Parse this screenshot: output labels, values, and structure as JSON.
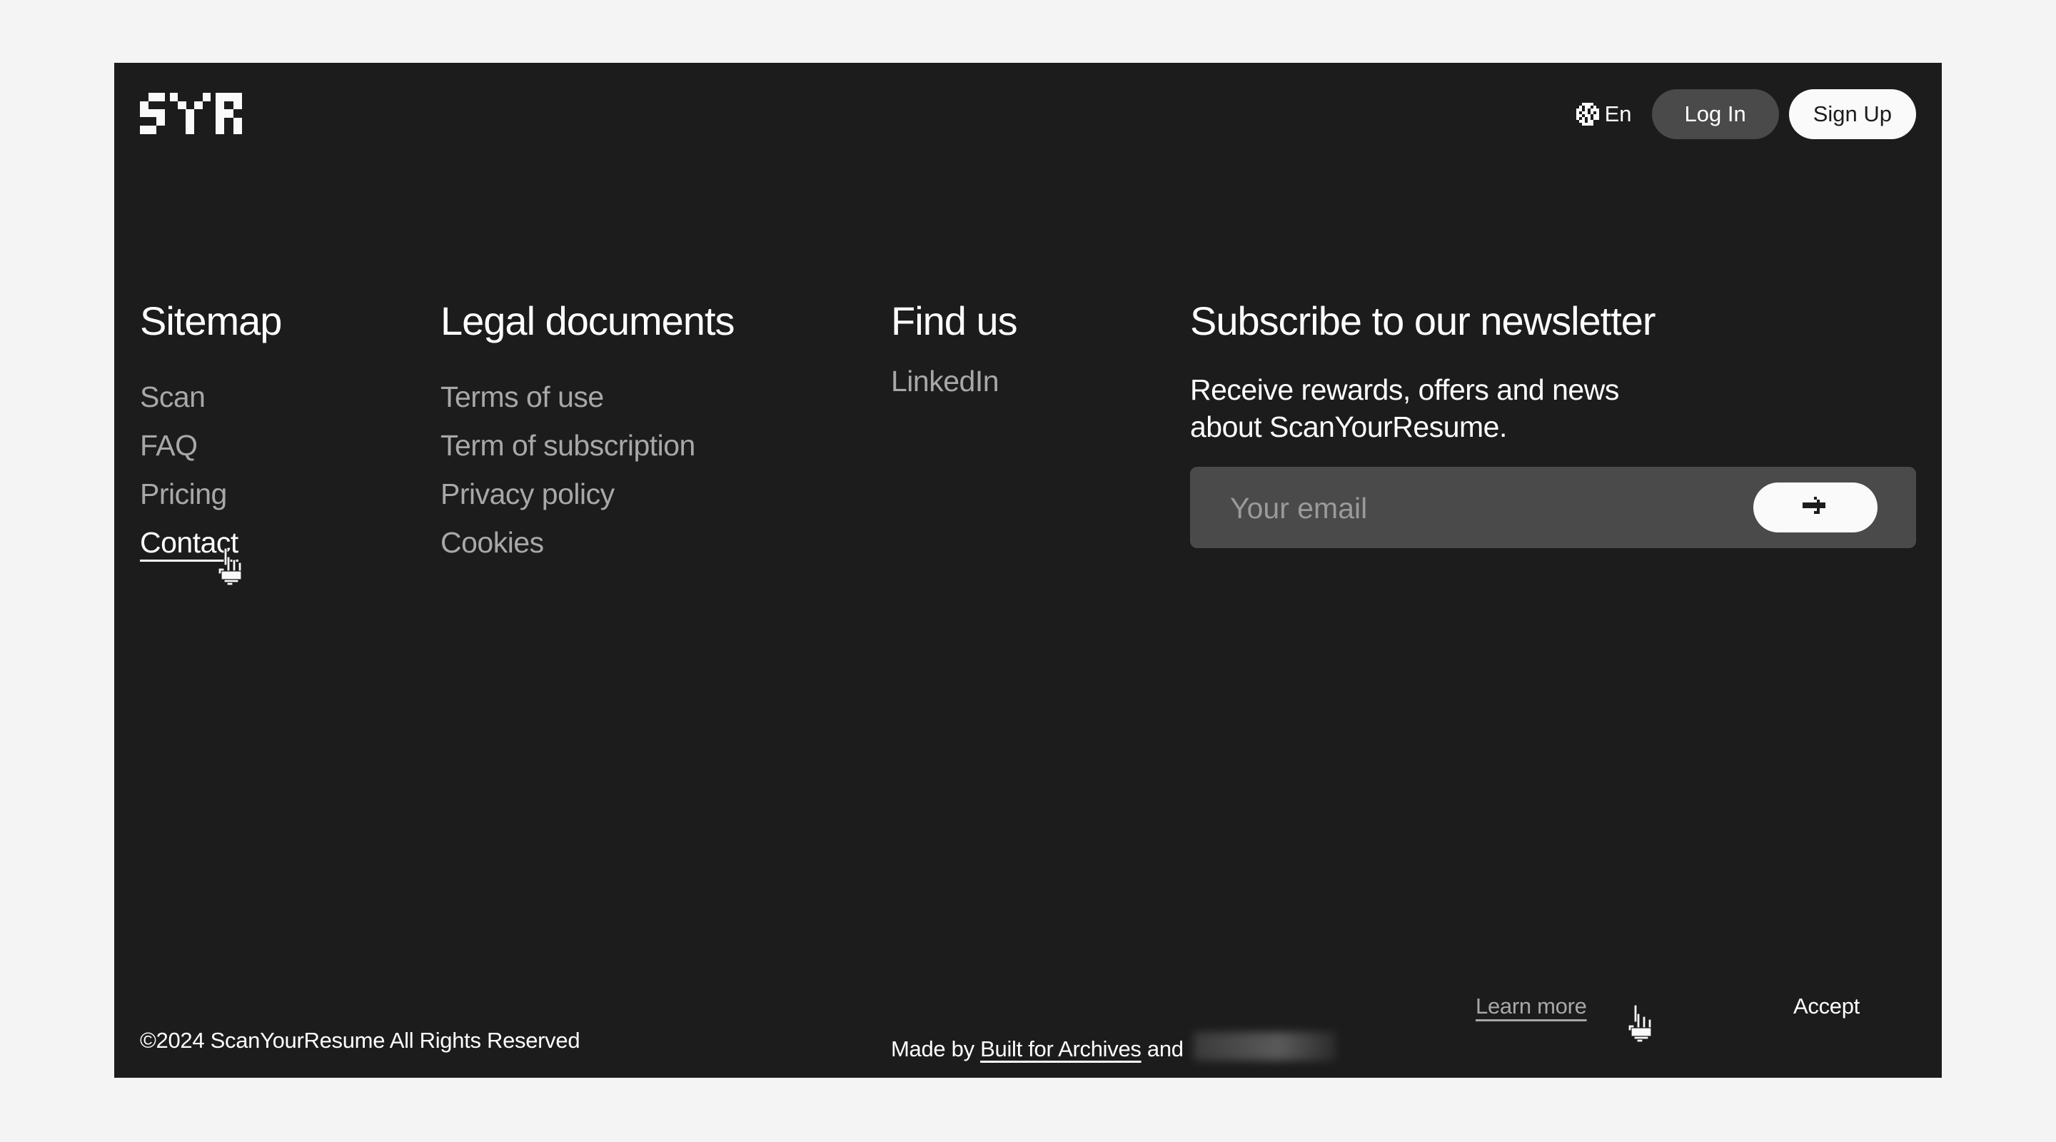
{
  "brand": {
    "logo_text": "SYR",
    "name": "ScanYourResume"
  },
  "header": {
    "language": {
      "icon": "globe-icon",
      "label": "En"
    },
    "login_label": "Log In",
    "signup_label": "Sign Up"
  },
  "footer": {
    "sitemap": {
      "title": "Sitemap",
      "items": [
        {
          "label": "Scan"
        },
        {
          "label": "FAQ"
        },
        {
          "label": "Pricing"
        },
        {
          "label": "Contact",
          "active": true
        }
      ]
    },
    "legal": {
      "title": "Legal documents",
      "items": [
        {
          "label": "Terms of use"
        },
        {
          "label": "Term of subscription"
        },
        {
          "label": "Privacy policy"
        },
        {
          "label": "Cookies"
        }
      ]
    },
    "find_us": {
      "title": "Find us",
      "items": [
        {
          "label": "LinkedIn"
        }
      ]
    },
    "newsletter": {
      "title": "Subscribe to our newsletter",
      "description": "Receive rewards, offers and news about ScanYourResume.",
      "email_placeholder": "Your email",
      "email_value": "",
      "submit_icon": "arrow-right-icon"
    },
    "copyright": "©2024 ScanYourResume All Rights Reserved",
    "made_by": {
      "prefix": "Made by ",
      "link1": "Built for Archives",
      "conjunction": " and "
    }
  },
  "cookie_banner": {
    "learn_more_label": "Learn more",
    "accept_label": "Accept"
  },
  "colors": {
    "page_bg": "#f4f4f4",
    "panel_bg": "#1c1c1c",
    "muted_text": "#a8a8a8",
    "button_dark": "#4a4a4a",
    "button_light": "#fafafa"
  }
}
